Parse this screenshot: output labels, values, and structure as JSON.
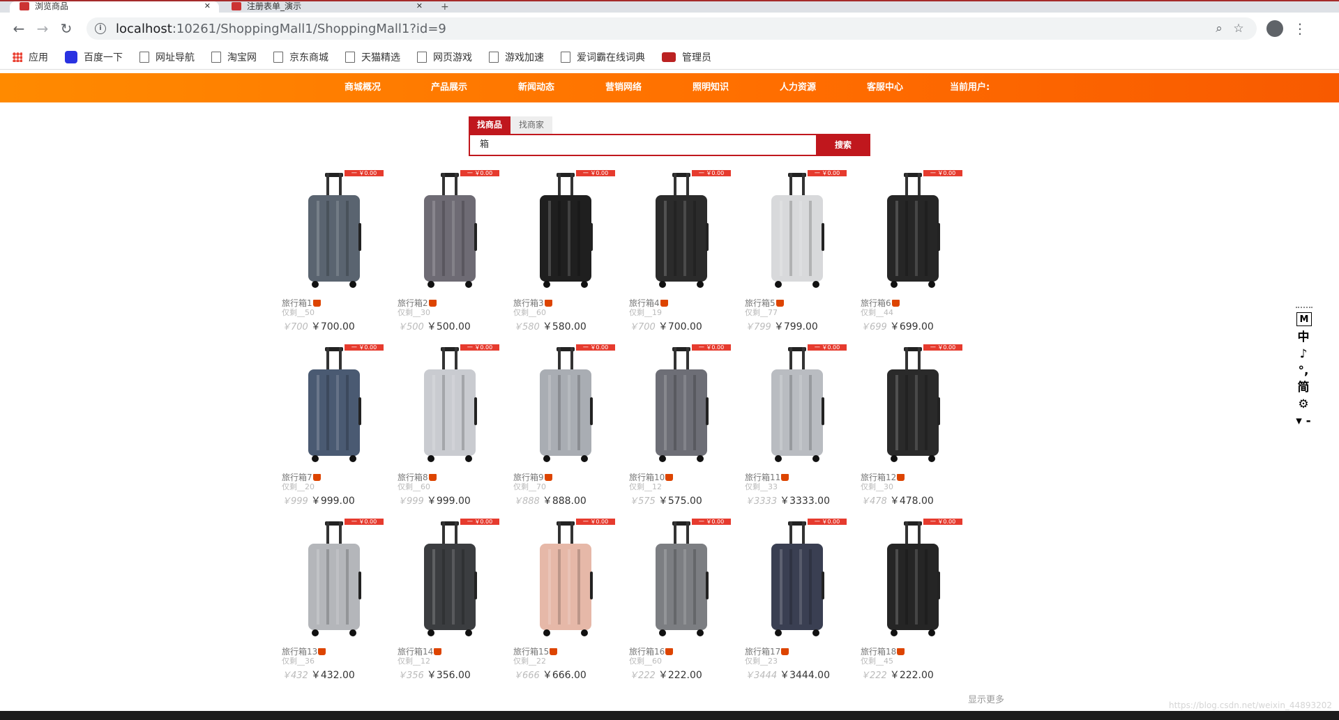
{
  "browser": {
    "tabs": [
      {
        "label": "浏览商品",
        "active": true
      },
      {
        "label": "注册表单_演示",
        "active": false
      }
    ],
    "new_tab": "+",
    "address": {
      "host": "localhost",
      "path": ":10261/ShoppingMall1/ShoppingMall1?id=9"
    },
    "bookmarks": [
      {
        "label": "应用",
        "icon": "apps-grid-icon"
      },
      {
        "label": "百度一下",
        "icon": "baidu-paw-icon"
      },
      {
        "label": "网址导航",
        "icon": "page-icon"
      },
      {
        "label": "淘宝网",
        "icon": "page-icon"
      },
      {
        "label": "京东商城",
        "icon": "page-icon"
      },
      {
        "label": "天猫精选",
        "icon": "page-icon"
      },
      {
        "label": "网页游戏",
        "icon": "page-icon"
      },
      {
        "label": "游戏加速",
        "icon": "page-icon"
      },
      {
        "label": "爱词霸在线词典",
        "icon": "page-icon"
      },
      {
        "label": "管理员",
        "icon": "truck-icon"
      }
    ]
  },
  "site_nav": [
    "商城概况",
    "产品展示",
    "新闻动态",
    "营销网络",
    "照明知识",
    "人力资源",
    "客服中心",
    "当前用户:"
  ],
  "search": {
    "tabs": [
      "找商品",
      "找商家"
    ],
    "query": "箱",
    "button": "搜索"
  },
  "products": [
    {
      "name": "旅行箱1",
      "sold": "仅剩__50",
      "old_price": "￥700",
      "price": "￥700.00",
      "tag": "一 ￥0.00"
    },
    {
      "name": "旅行箱2",
      "sold": "仅剩__30",
      "old_price": "￥500",
      "price": "￥500.00",
      "tag": "一 ￥0.00"
    },
    {
      "name": "旅行箱3",
      "sold": "仅剩__60",
      "old_price": "￥580",
      "price": "￥580.00",
      "tag": "一 ￥0.00"
    },
    {
      "name": "旅行箱4",
      "sold": "仅剩__19",
      "old_price": "￥700",
      "price": "￥700.00",
      "tag": "一 ￥0.00"
    },
    {
      "name": "旅行箱5",
      "sold": "仅剩__77",
      "old_price": "￥799",
      "price": "￥799.00",
      "tag": "一 ￥0.00"
    },
    {
      "name": "旅行箱6",
      "sold": "仅剩__44",
      "old_price": "￥699",
      "price": "￥699.00",
      "tag": "一 ￥0.00"
    },
    {
      "name": "旅行箱7",
      "sold": "仅剩__20",
      "old_price": "￥999",
      "price": "￥999.00",
      "tag": "一 ￥0.00"
    },
    {
      "name": "旅行箱8",
      "sold": "仅剩__60",
      "old_price": "￥999",
      "price": "￥999.00",
      "tag": "一 ￥0.00"
    },
    {
      "name": "旅行箱9",
      "sold": "仅剩__70",
      "old_price": "￥888",
      "price": "￥888.00",
      "tag": "一 ￥0.00"
    },
    {
      "name": "旅行箱10",
      "sold": "仅剩__12",
      "old_price": "￥575",
      "price": "￥575.00",
      "tag": "一 ￥0.00"
    },
    {
      "name": "旅行箱11",
      "sold": "仅剩__33",
      "old_price": "￥3333",
      "price": "￥3333.00",
      "tag": "一 ￥0.00"
    },
    {
      "name": "旅行箱12",
      "sold": "仅剩__30",
      "old_price": "￥478",
      "price": "￥478.00",
      "tag": "一 ￥0.00"
    },
    {
      "name": "旅行箱13",
      "sold": "仅剩__36",
      "old_price": "￥432",
      "price": "￥432.00",
      "tag": "一 ￥0.00"
    },
    {
      "name": "旅行箱14",
      "sold": "仅剩__12",
      "old_price": "￥356",
      "price": "￥356.00",
      "tag": "一 ￥0.00"
    },
    {
      "name": "旅行箱15",
      "sold": "仅剩__22",
      "old_price": "￥666",
      "price": "￥666.00",
      "tag": "一 ￥0.00"
    },
    {
      "name": "旅行箱16",
      "sold": "仅剩__60",
      "old_price": "￥222",
      "price": "￥222.00",
      "tag": "一 ￥0.00"
    },
    {
      "name": "旅行箱17",
      "sold": "仅剩__23",
      "old_price": "￥3444",
      "price": "￥3444.00",
      "tag": "一 ￥0.00"
    },
    {
      "name": "旅行箱18",
      "sold": "仅剩__45",
      "old_price": "￥222",
      "price": "￥222.00",
      "tag": "一 ￥0.00"
    }
  ],
  "more_link": "显示更多",
  "ime": [
    "M",
    "中",
    "♪",
    "°,",
    "简",
    "⚙",
    "▾ -"
  ],
  "watermark": "https://blog.csdn.net/weixin_44893202",
  "colors": {
    "nav_orange": "#ff7a00",
    "brand_red": "#c0171d",
    "tag_red": "#e63b2e"
  }
}
